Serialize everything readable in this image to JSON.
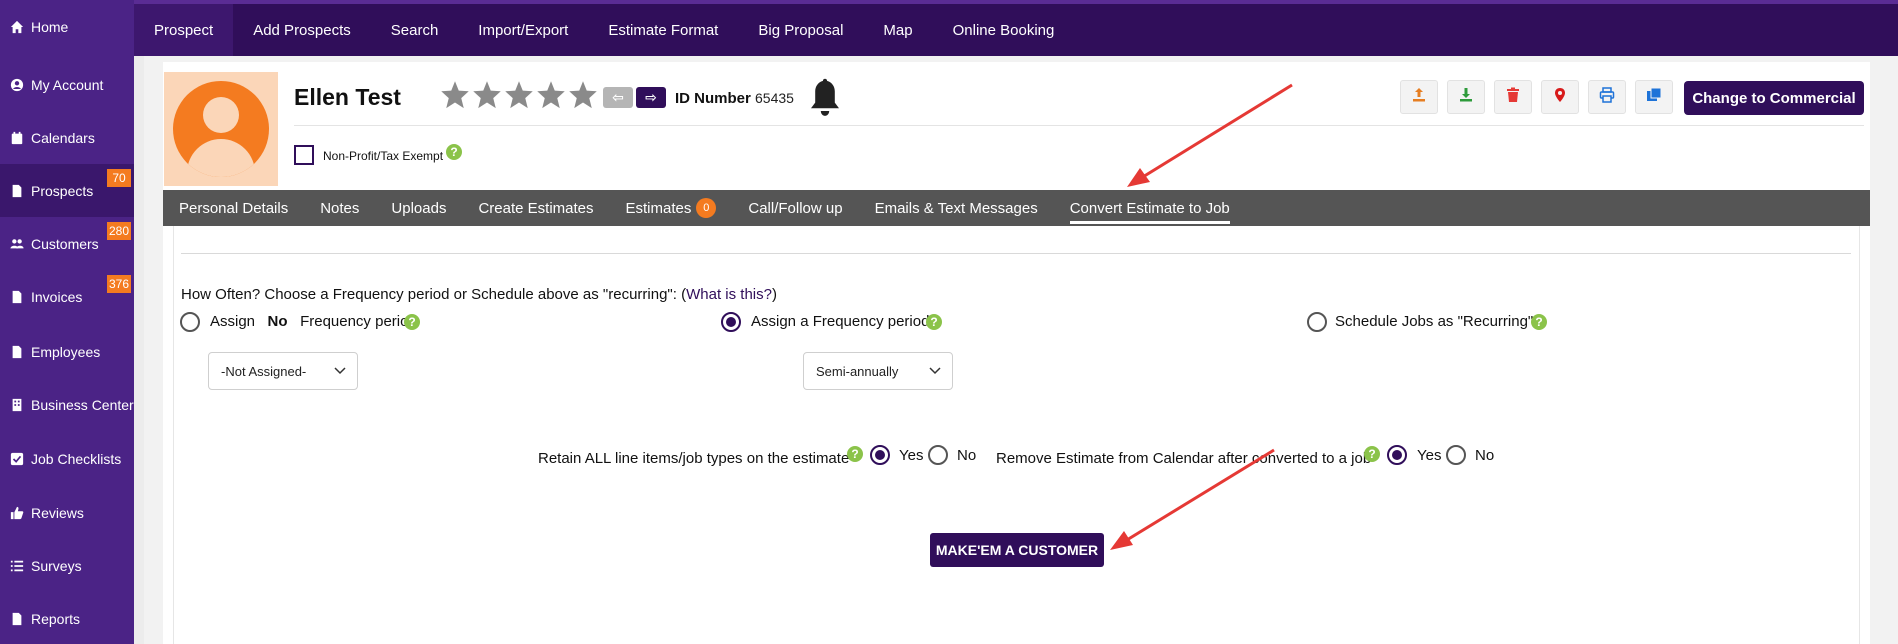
{
  "sidebar": {
    "items": [
      {
        "label": "Home",
        "icon": "home-icon"
      },
      {
        "label": "My Account",
        "icon": "user-circle-icon"
      },
      {
        "label": "Calendars",
        "icon": "calendar-icon"
      },
      {
        "label": "Prospects",
        "icon": "file-icon",
        "badge": "70"
      },
      {
        "label": "Customers",
        "icon": "users-icon",
        "badge": "280"
      },
      {
        "label": "Invoices",
        "icon": "file-icon",
        "badge": "376"
      },
      {
        "label": "Employees",
        "icon": "file-icon"
      },
      {
        "label": "Business Center",
        "icon": "building-icon"
      },
      {
        "label": "Job Checklists",
        "icon": "checkbox-icon"
      },
      {
        "label": "Reviews",
        "icon": "thumbs-up-icon"
      },
      {
        "label": "Surveys",
        "icon": "list-icon"
      },
      {
        "label": "Reports",
        "icon": "file-icon"
      }
    ]
  },
  "topnav": {
    "items": [
      "Prospect",
      "Add Prospects",
      "Search",
      "Import/Export",
      "Estimate Format",
      "Big Proposal",
      "Map",
      "Online Booking"
    ]
  },
  "header": {
    "name": "Ellen Test",
    "id_label": "ID Number",
    "id_value": "65435",
    "nonprofit_label": "Non-Profit/Tax Exempt",
    "change_button": "Change to Commercial",
    "help_glyph": "?",
    "prev_glyph": "⇦",
    "next_glyph": "⇨"
  },
  "tabs": [
    {
      "label": "Personal Details"
    },
    {
      "label": "Notes"
    },
    {
      "label": "Uploads"
    },
    {
      "label": "Create Estimates"
    },
    {
      "label": "Estimates",
      "count": "0"
    },
    {
      "label": "Call/Follow up"
    },
    {
      "label": "Emails & Text Messages"
    },
    {
      "label": "Convert Estimate to Job"
    }
  ],
  "form": {
    "how_often_text": "How Often? Choose a Frequency period or Schedule above as \"recurring\":",
    "how_often_paren_open": "(",
    "how_often_link": "What is this?",
    "how_often_paren_close": ")",
    "assign_no_prefix": "Assign",
    "assign_no_bold": "No",
    "assign_no_suffix": "Frequency period",
    "assign_freq": "Assign a Frequency period",
    "schedule_recurring": "Schedule Jobs as \"Recurring\"",
    "select_not_assigned": "-Not Assigned-",
    "select_semiannually": "Semi-annually",
    "retain_label": "Retain ALL line items/job types on the estimate",
    "remove_label": "Remove Estimate from Calendar after converted to a job",
    "yes": "Yes",
    "no": "No",
    "make_customer": "MAKE'EM A CUSTOMER"
  },
  "colors": {
    "sidebar": "#4b2386",
    "topnav": "#300e5a",
    "accent": "#300e5a",
    "badge": "#f47b20",
    "help": "#8bc34a",
    "annotation_arrow": "#e53935"
  }
}
